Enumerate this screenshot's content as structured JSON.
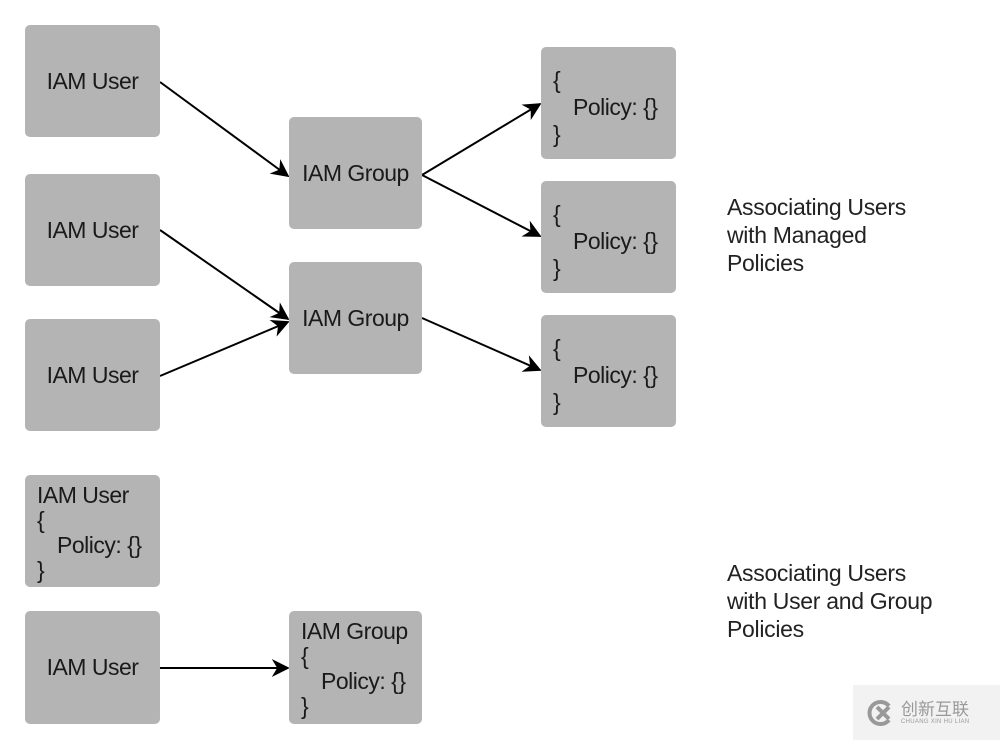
{
  "diagram": {
    "managed": {
      "users": [
        "IAM User",
        "IAM User",
        "IAM User"
      ],
      "groups": [
        "IAM Group",
        "IAM Group"
      ],
      "policies": [
        {
          "open": "{",
          "body": "Policy: {}",
          "close": "}"
        },
        {
          "open": "{",
          "body": "Policy: {}",
          "close": "}"
        },
        {
          "open": "{",
          "body": "Policy: {}",
          "close": "}"
        }
      ],
      "caption": [
        "Associating Users",
        "with Managed",
        "Policies"
      ]
    },
    "inline": {
      "user_with_policy": {
        "title": "IAM User",
        "open": "{",
        "body": "Policy: {}",
        "close": "}"
      },
      "user": "IAM User",
      "group_with_policy": {
        "title": "IAM Group",
        "open": "{",
        "body": "Policy: {}",
        "close": "}"
      },
      "caption": [
        "Associating Users",
        "with User and Group",
        "Policies"
      ]
    },
    "colors": {
      "box": "#b4b4b4",
      "arrow": "#000000"
    }
  },
  "watermark": {
    "chinese": "创新互联",
    "english": "CHUANG XIN HU LIAN"
  }
}
